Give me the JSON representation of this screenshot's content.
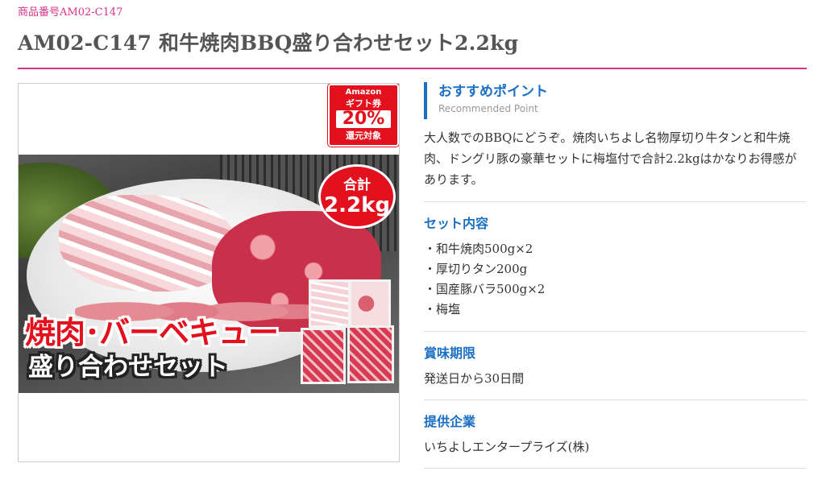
{
  "header": {
    "product_code": "商品番号AM02-C147",
    "title": "AM02-C147 和牛焼肉BBQ盛り合わせセット2.2kg"
  },
  "image": {
    "gift_badge": {
      "line1": "Amazon",
      "line2": "ギフト券",
      "line3": "20%",
      "line4": "還元対象"
    },
    "total_badge": {
      "line1": "合計",
      "line2": "2.2kg"
    },
    "overlay_line1": "焼肉･バーベキュー",
    "overlay_line2": "盛り合わせセット"
  },
  "recommended": {
    "title": "おすすめポイント",
    "subtitle": "Recommended Point",
    "body": "大人数でのBBQにどうぞ。焼肉いちよし名物厚切り牛タンと和牛焼肉、ドングリ豚の豪華セットに梅塩付で合計2.2kgはかなりお得感があります。"
  },
  "set_contents": {
    "heading": "セット内容",
    "items": [
      "・和牛焼肉500g×2",
      "・厚切りタン200g",
      "・国産豚バラ500g×2",
      "・梅塩"
    ]
  },
  "expiry": {
    "heading": "賞味期限",
    "text": "発送日から30日間"
  },
  "provider": {
    "heading": "提供企業",
    "text": "いちよしエンタープライズ(株)"
  },
  "colors": {
    "accent_pink": "#d7338a",
    "heading_blue": "#1b6fc2",
    "badge_red": "#e2111d"
  }
}
